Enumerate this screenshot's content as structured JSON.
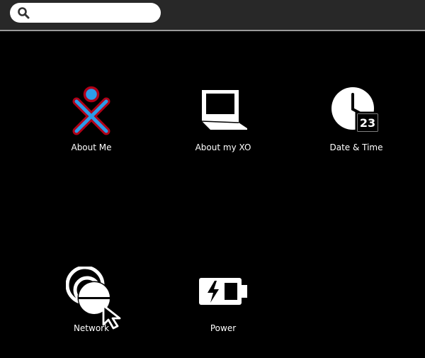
{
  "toolbar": {
    "search": {
      "value": "",
      "placeholder": "",
      "icon": "search-icon"
    }
  },
  "items": {
    "about_me": {
      "label": "About Me",
      "icon": "xo-person-icon",
      "stroke": "#b00018",
      "fill": "#2d9ce8"
    },
    "about_xo": {
      "label": "About my XO",
      "icon": "laptop-icon"
    },
    "date_time": {
      "label": "Date & Time",
      "icon": "clock-icon",
      "day": "23"
    },
    "network": {
      "label": "Network",
      "icon": "network-icon"
    },
    "power": {
      "label": "Power",
      "icon": "battery-icon"
    }
  },
  "colors": {
    "background": "#000000",
    "toolbar": "#282828",
    "text": "#ffffff"
  }
}
